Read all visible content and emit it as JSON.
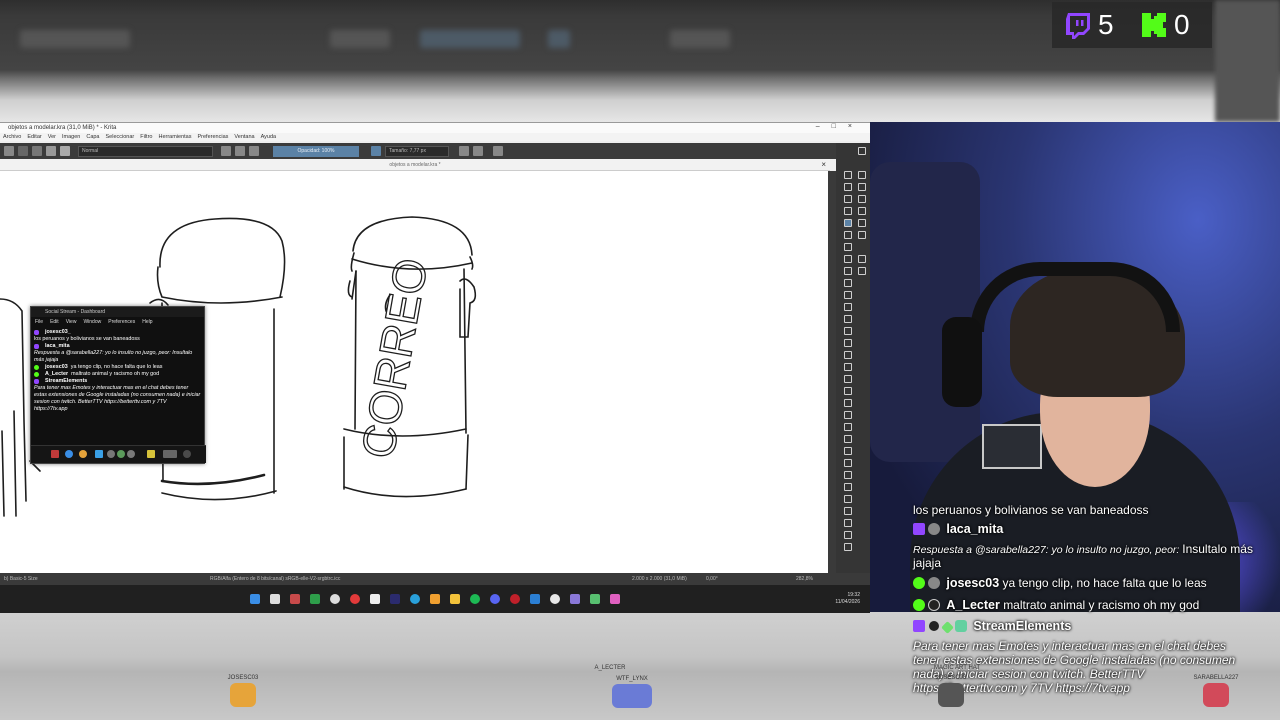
{
  "counters": {
    "twitch_count": "5",
    "kick_count": "0"
  },
  "krita": {
    "window_title": "objetos a modelar.kra (31,0 MiB) * - Krita",
    "menu": [
      "Archivo",
      "Editar",
      "Ver",
      "Imagen",
      "Capa",
      "Seleccionar",
      "Filtro",
      "Herramientas",
      "Preferencias",
      "Ventana",
      "Ayuda"
    ],
    "blend_mode": "Normal",
    "opacity": "Opacidad: 100%",
    "size": "Tamaño: 7,77 px",
    "doc_tab": "objetos a modelar.kra *",
    "canvas_text": "CORREO",
    "status": {
      "brush": "b) Basic-5 Size",
      "color": "RGB/Alfa (Entero de 8 bits/canal)  sRGB-elle-V2-srgbtrc.icc",
      "dims": "2.000 x 2.000 (31,0 MiB)",
      "angle": "0,00°",
      "zoom": "282,8%"
    },
    "clock": {
      "time": "19:32",
      "date": "11/04/2026"
    }
  },
  "float_chat": {
    "title": "Social Stream - Dashboard",
    "menu": [
      "File",
      "Edit",
      "View",
      "Window",
      "Preferences",
      "Help"
    ],
    "lines": [
      {
        "name": "josesc03_",
        "text": ""
      },
      {
        "name": "",
        "text": "los peruanos y bolivianos se van baneadoss"
      },
      {
        "name": "laca_mita",
        "text": ""
      },
      {
        "name": "",
        "text": "Respuesta a @sarabella227: yo lo insulto no juzgo, peor: Insultalo más jajaja"
      },
      {
        "name": "josesc03",
        "text": "ya tengo clip, no hace falta que lo leas"
      },
      {
        "name": "A_Lecter",
        "text": "maltrato animal y racismo oh my god"
      },
      {
        "name": "StreamElements",
        "text": ""
      },
      {
        "name": "",
        "text": "Para tener mas Emotes y interactuar mas en el chat debes tener estas extensiones de Google instaladas (no consumen nada) e iniciar sesion con twitch. BetterTTV https://betterttv.com y 7TV https://7tv.app"
      }
    ]
  },
  "overlay_chat": {
    "m1_text": "los peruanos y bolivianos se van baneadoss",
    "m2_name": "laca_mita",
    "m3_text1": "Respuesta a @sarabella227: yo lo insulto no juzgo, peor:",
    "m3_text2": "Insultalo más",
    "m3_text3": "jajaja",
    "m4_name": "josesc03",
    "m4_text": "ya tengo clip, no hace falta que lo leas",
    "m5_name": "A_Lecter",
    "m5_text": "maltrato animal y racismo oh my god",
    "m6_name": "StreamElements",
    "m6_l1": "Para tener mas Emotes y interactuar mas en el chat debes",
    "m6_l2": "tener estas extensiones de Google instaladas (no consumen",
    "m6_l3": "nada) e iniciar sesion con twitch. BetterTTV",
    "m6_l4": "https://betterttv.com y 7TV https://7tv.app"
  },
  "pets": {
    "p1": "JOSESC03",
    "p2": "A_LECTER",
    "p3": "WTF_LYNX",
    "p4": "MAGIC ART HAT",
    "p5": "JOSESC03",
    "p6": "SARABELLA227"
  }
}
